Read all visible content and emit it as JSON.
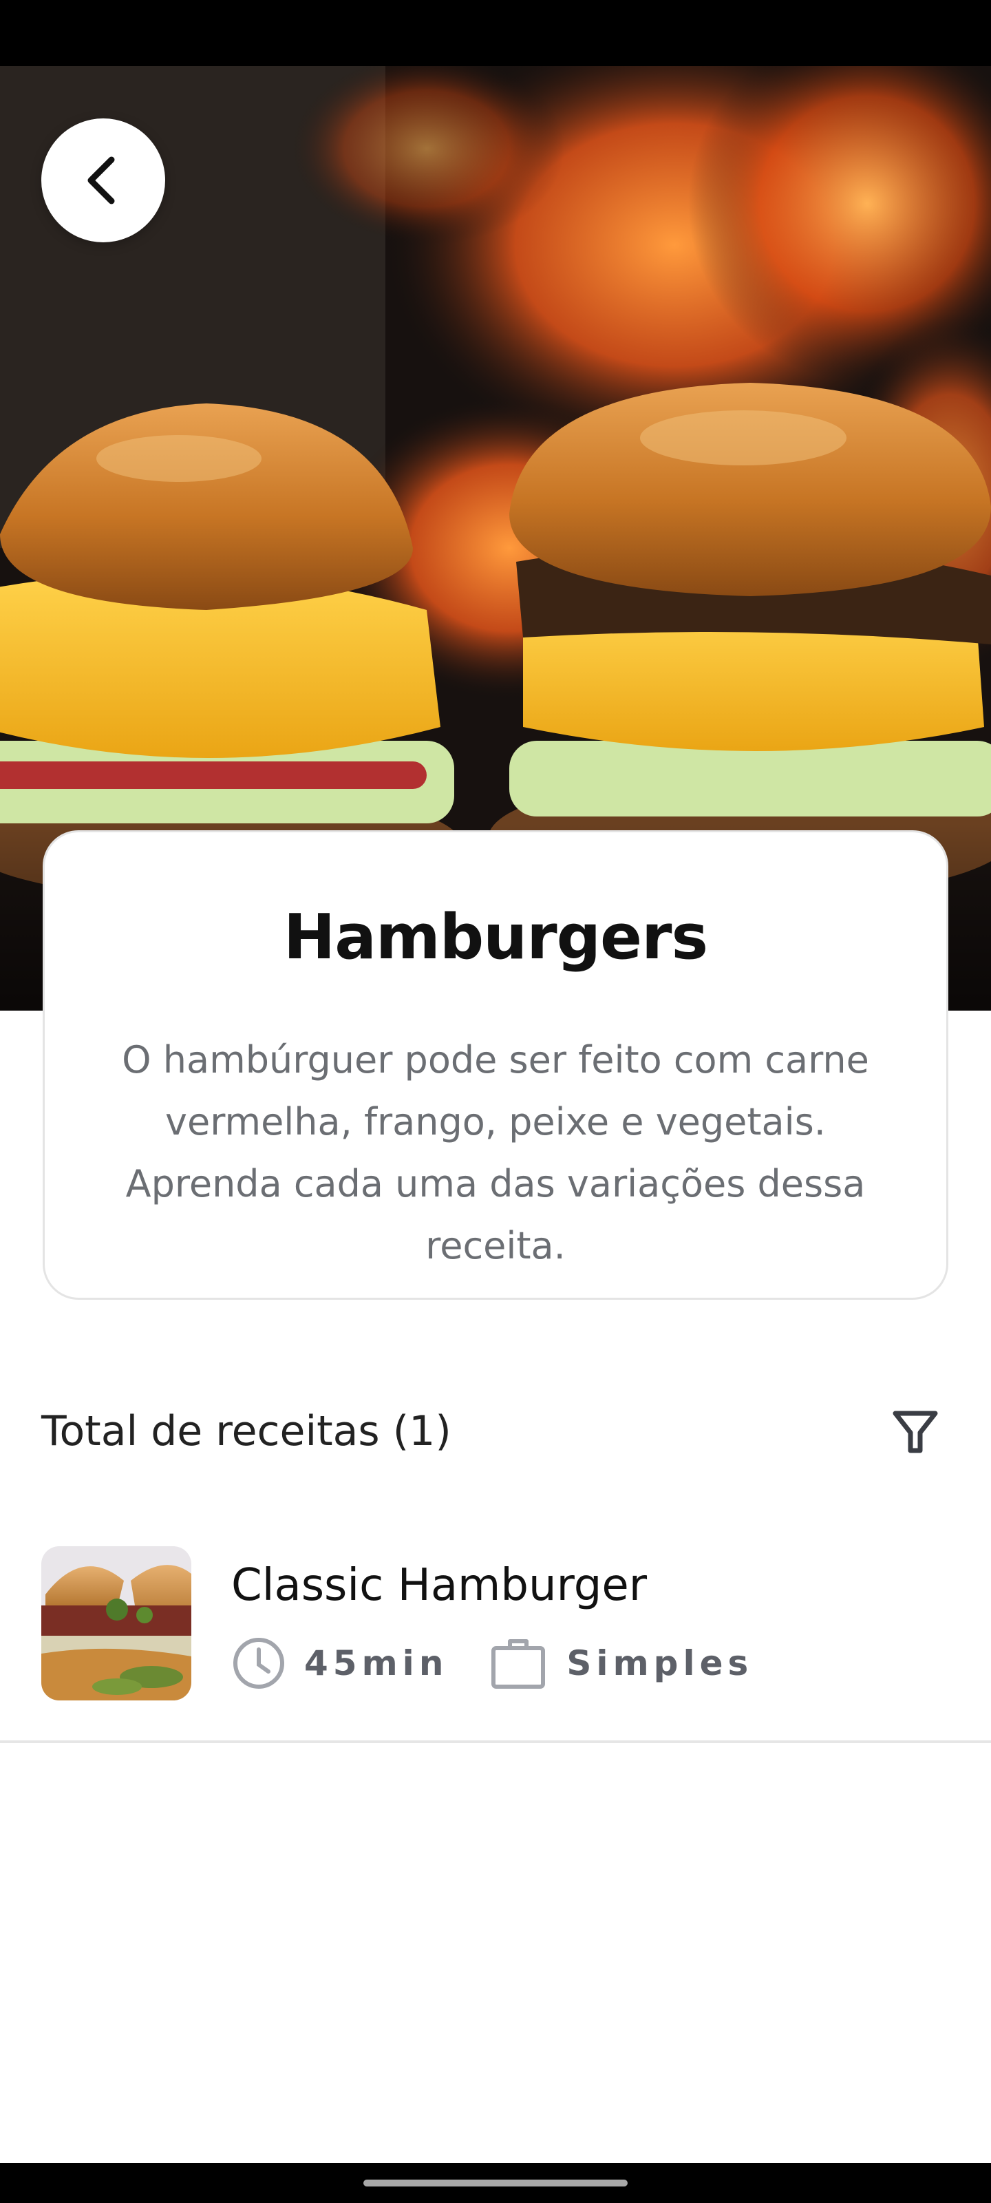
{
  "category": {
    "title": "Hamburgers",
    "description": "O hambúrguer pode ser feito com carne vermelha, frango, peixe e vegetais. Aprenda cada uma das variações dessa receita."
  },
  "recipes_section": {
    "total_label": "Total de receitas (1)",
    "filter_icon": "filter-icon"
  },
  "recipes": [
    {
      "name": "Classic Hamburger",
      "time": "45min",
      "difficulty": "Simples",
      "time_icon": "clock-icon",
      "difficulty_icon": "briefcase-icon"
    }
  ],
  "navigation": {
    "back_icon": "chevron-left-icon"
  },
  "colors": {
    "title": "#111111",
    "description": "#6b6e73",
    "meta": "#5d6068",
    "card_border": "#e4e4e4",
    "divider": "#e6e6e6"
  }
}
